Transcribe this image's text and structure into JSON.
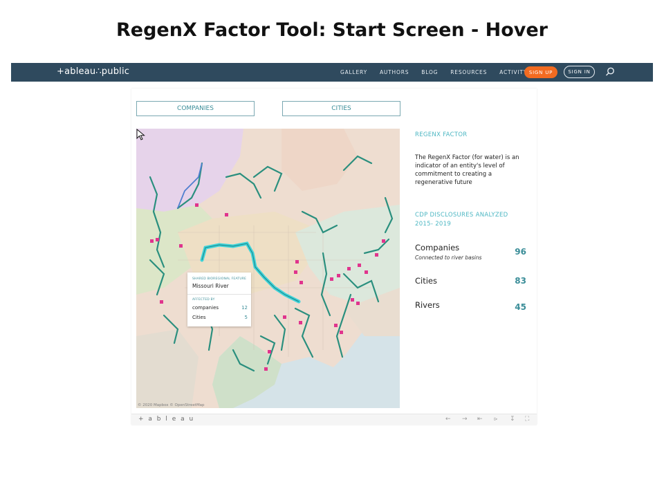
{
  "slide": {
    "title": "RegenX Factor Tool: Start Screen - Hover"
  },
  "nav": {
    "logo": "+ableau∴public",
    "links": [
      "GALLERY",
      "AUTHORS",
      "BLOG",
      "RESOURCES",
      "ACTIVITY"
    ],
    "signup": "SIGN UP",
    "signin": "SIGN IN",
    "colors": {
      "bar": "#2f4a5e",
      "signup": "#f26b21"
    }
  },
  "tabs": {
    "companies": "COMPANIES",
    "cities": "CITIES"
  },
  "map": {
    "attribution": "© 2020 Mapbox © OpenStreetMap",
    "tooltip": {
      "header": "SHARED BIOREGIONAL FEATURE",
      "river": "Missouri River",
      "affected_by": "AFFECTED BY",
      "rows": [
        {
          "label": "companies",
          "value": "12"
        },
        {
          "label": "Cities",
          "value": "5"
        }
      ]
    },
    "colors": {
      "river": "#2a8f7e",
      "highlight": "#3fd4d9",
      "marker": "#e0348d"
    }
  },
  "panel": {
    "heading1": "REGENX FACTOR",
    "description": "The RegenX Factor (for water) is an indicator of an entity's level of commitment to creating a regenerative future",
    "heading2_line1": "CDP DISCLOSURES ANALYZED",
    "heading2_line2": "2015- 2019",
    "stats": [
      {
        "label": "Companies",
        "sub": "Connected to river basins",
        "value": "96"
      },
      {
        "label": "Cities",
        "sub": "",
        "value": "83"
      },
      {
        "label": "Rivers",
        "sub": "",
        "value": "45"
      }
    ],
    "accent": "#4db7c3"
  },
  "toolbar": {
    "logo": "+ a b l e a u"
  }
}
